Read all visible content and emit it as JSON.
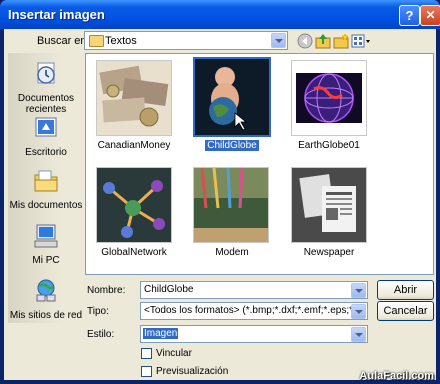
{
  "window": {
    "title": "Insertar imagen",
    "help_glyph": "?",
    "close_glyph": "✕"
  },
  "lookin": {
    "label": "Buscar en:",
    "value": "Textos"
  },
  "toolbar": {
    "icons": [
      "back-icon",
      "up-folder-icon",
      "new-folder-icon",
      "views-icon"
    ]
  },
  "places": [
    {
      "label": "Documentos recientes",
      "icon": "recent-documents-icon"
    },
    {
      "label": "Escritorio",
      "icon": "desktop-icon"
    },
    {
      "label": "Mis documentos",
      "icon": "my-documents-icon"
    },
    {
      "label": "Mi PC",
      "icon": "my-computer-icon"
    },
    {
      "label": "Mis sitios de red",
      "icon": "network-places-icon"
    }
  ],
  "files": [
    {
      "name": "CanadianMoney",
      "selected": false
    },
    {
      "name": "ChildGlobe",
      "selected": true
    },
    {
      "name": "EarthGlobe01",
      "selected": false
    },
    {
      "name": "GlobalNetwork",
      "selected": false
    },
    {
      "name": "Modem",
      "selected": false
    },
    {
      "name": "Newspaper",
      "selected": false
    }
  ],
  "form": {
    "name_label": "Nombre:",
    "name_value": "ChildGlobe",
    "type_label": "Tipo:",
    "type_value": "<Todos los formatos> (*.bmp;*.dxf;*.emf;*.eps;*.gif;*.jpg;*.",
    "style_label": "Estilo:",
    "style_value": "Imagen",
    "link_label": "Vincular",
    "preview_label": "Previsualización"
  },
  "buttons": {
    "open": "Abrir",
    "cancel": "Cancelar"
  },
  "watermark": "AulaFacil.com"
}
